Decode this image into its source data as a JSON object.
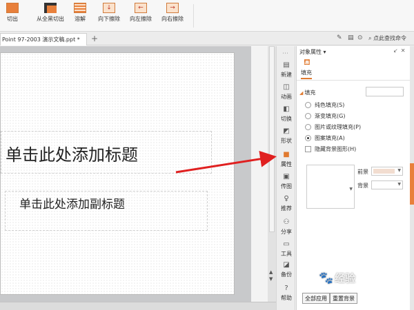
{
  "ribbon": {
    "buttons": [
      "切出",
      "从全黑切出",
      "溶解",
      "向下擦除",
      "向左擦除",
      "向右擦除"
    ]
  },
  "tabbar": {
    "doc_title": "Point 97-2003 演示文稿.ppt *",
    "add": "+",
    "find_command": "点此查找命令"
  },
  "slide": {
    "title_placeholder": "单击此处添加标题",
    "subtitle_placeholder": "单击此处添加副标题"
  },
  "side_tools": {
    "items": [
      "新建",
      "动画",
      "切换",
      "形状",
      "属性",
      "传图",
      "推荐",
      "分享",
      "工具",
      "备份",
      "帮助"
    ],
    "active": "属性"
  },
  "property_panel": {
    "title": "对象属性 ▾",
    "tab": "填充",
    "section": "填充",
    "fill_options": [
      "纯色填充(S)",
      "渐变填充(G)",
      "图片或纹理填充(P)",
      "图案填充(A)"
    ],
    "selected_fill": "图案填充(A)",
    "hide_background": "隐藏背景图形(H)",
    "foreground_label": "前景",
    "background_label": "背景",
    "apply_all": "全部应用",
    "reset_bg": "重置背景"
  },
  "colors": {
    "accent": "#e8803c",
    "arrow": "#e02020",
    "foreground_swatch": "#f2ddd0",
    "background_swatch": "#ffffff"
  },
  "watermark": {
    "text": "经验"
  }
}
